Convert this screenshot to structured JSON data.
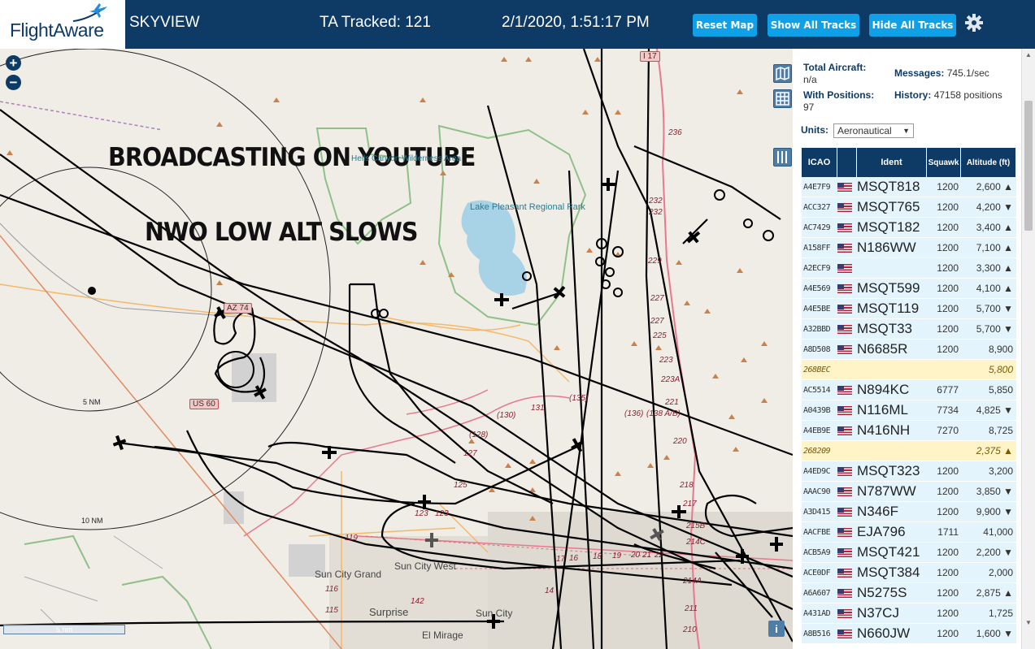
{
  "header": {
    "brand": "FlightAware",
    "app_name": "SKYVIEW",
    "tracked": "TA Tracked: 121",
    "datetime": "2/1/2020, 1:51:17 PM",
    "buttons": {
      "reset": "Reset Map",
      "show": "Show All Tracks",
      "hide": "Hide All Tracks"
    },
    "settings_icon": "gear-icon"
  },
  "map": {
    "zoom_in": "+",
    "zoom_out": "−",
    "overlay_line1": "BROADCASTING ON YOUTUBE",
    "overlay_line2": "NWO LOW ALT SLOWS",
    "labels": {
      "lake": "Lake Pleasant Regional Park",
      "hieroglyphic": "Hells Canyon Wilderness Area",
      "sun_city_west": "Sun City West",
      "sun_city_grand": "Sun City Grand",
      "surprise": "Surprise",
      "sun_city": "Sun City",
      "el_mirage": "El Mirage",
      "us60": "US 60",
      "az74": "AZ 74",
      "i17": "I 17",
      "ring5": "5 NM",
      "ring10": "10 NM",
      "scale": "5 nm",
      "info": "i"
    },
    "road_numbers": [
      "236",
      "232",
      "232",
      "229",
      "227",
      "227",
      "225",
      "223",
      "223A",
      "221",
      "220",
      "218",
      "217",
      "215B",
      "214C",
      "214A",
      "211",
      "210",
      "131",
      "(135)",
      "(130)",
      "(128)",
      "127",
      "(136)",
      "(138 A/B)",
      "125",
      "123",
      "123",
      "119",
      "116",
      "115",
      "142",
      "14",
      "17",
      "16",
      "18",
      "19",
      "20",
      "21",
      "22"
    ]
  },
  "stats": {
    "total_label": "Total Aircraft:",
    "total_value": "n/a",
    "messages_label": "Messages:",
    "messages_value": "745.1/sec",
    "positions_label": "With Positions:",
    "positions_value": "97",
    "history_label": "History:",
    "history_value": "47158 positions",
    "units_label": "Units:",
    "units_value": "Aeronautical"
  },
  "table": {
    "headers": {
      "icao": "ICAO",
      "ident": "Ident",
      "squawk": "Squawk",
      "altitude": "Altitude (ft)"
    },
    "rows": [
      {
        "icao": "A4E7F9",
        "ident": "MSQT818",
        "squawk": "1200",
        "alt": "2,600 ▲",
        "hl": false
      },
      {
        "icao": "ACC327",
        "ident": "MSQT765",
        "squawk": "1200",
        "alt": "4,200 ▼",
        "hl": false
      },
      {
        "icao": "AC7429",
        "ident": "MSQT182",
        "squawk": "1200",
        "alt": "3,400 ▲",
        "hl": false
      },
      {
        "icao": "A158FF",
        "ident": "N186WW",
        "squawk": "1200",
        "alt": "7,100 ▲",
        "hl": false
      },
      {
        "icao": "A2ECF9",
        "ident": "",
        "squawk": "1200",
        "alt": "3,300 ▲",
        "hl": false
      },
      {
        "icao": "A4E569",
        "ident": "MSQT599",
        "squawk": "1200",
        "alt": "4,100 ▲",
        "hl": false
      },
      {
        "icao": "A4E5BE",
        "ident": "MSQT119",
        "squawk": "1200",
        "alt": "5,700 ▼",
        "hl": false
      },
      {
        "icao": "A32BBD",
        "ident": "MSQT33",
        "squawk": "1200",
        "alt": "5,700 ▼",
        "hl": false
      },
      {
        "icao": "A8D508",
        "ident": "N6685R",
        "squawk": "1200",
        "alt": "8,900",
        "hl": false
      },
      {
        "icao": "268BEC",
        "ident": "",
        "squawk": "",
        "alt": "5,800",
        "hl": true
      },
      {
        "icao": "AC5514",
        "ident": "N894KC",
        "squawk": "6777",
        "alt": "5,850",
        "hl": false
      },
      {
        "icao": "A0439B",
        "ident": "N116ML",
        "squawk": "7734",
        "alt": "4,825 ▼",
        "hl": false
      },
      {
        "icao": "A4EB9E",
        "ident": "N416NH",
        "squawk": "7270",
        "alt": "8,725",
        "hl": false
      },
      {
        "icao": "268209",
        "ident": "",
        "squawk": "",
        "alt": "2,375 ▲",
        "hl": true
      },
      {
        "icao": "A4ED9C",
        "ident": "MSQT323",
        "squawk": "1200",
        "alt": "3,200",
        "hl": false
      },
      {
        "icao": "AAAC90",
        "ident": "N787WW",
        "squawk": "1200",
        "alt": "3,850 ▼",
        "hl": false
      },
      {
        "icao": "A3D415",
        "ident": "N346F",
        "squawk": "1200",
        "alt": "9,900 ▼",
        "hl": false
      },
      {
        "icao": "AACFBE",
        "ident": "EJA796",
        "squawk": "1711",
        "alt": "41,000",
        "hl": false
      },
      {
        "icao": "ACB5A9",
        "ident": "MSQT421",
        "squawk": "1200",
        "alt": "2,200 ▼",
        "hl": false
      },
      {
        "icao": "ACE0DF",
        "ident": "MSQT384",
        "squawk": "1200",
        "alt": "2,000",
        "hl": false
      },
      {
        "icao": "A6A607",
        "ident": "N5275S",
        "squawk": "1200",
        "alt": "2,875 ▲",
        "hl": false
      },
      {
        "icao": "A431AD",
        "ident": "N37CJ",
        "squawk": "1200",
        "alt": "1,725",
        "hl": false
      },
      {
        "icao": "A8B516",
        "ident": "N660JW",
        "squawk": "1200",
        "alt": "1,600 ▼",
        "hl": false
      }
    ]
  },
  "colors": {
    "header_bg": "#0e3a66",
    "button": "#10a0e8",
    "row_bg": "#e4f4fc",
    "row_hl": "#fef4c8"
  }
}
